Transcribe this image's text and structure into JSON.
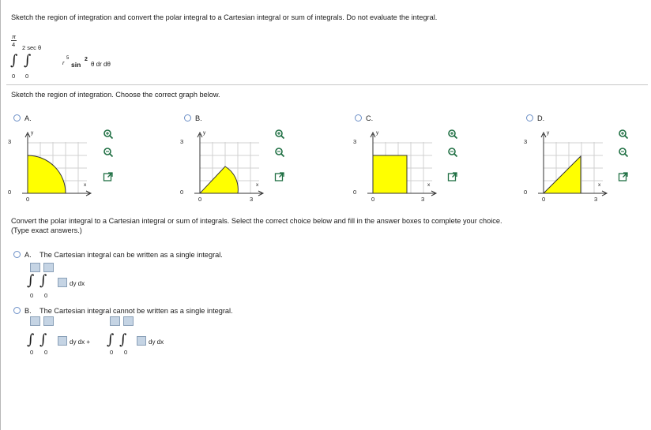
{
  "question": {
    "prompt": "Sketch the region of integration and convert the polar integral to a Cartesian integral or sum of integrals. Do not evaluate the integral.",
    "integral": {
      "outer_upper": "π",
      "outer_upper_den": "4",
      "outer_lower": "0",
      "inner_upper": "2 sec θ",
      "inner_lower": "0",
      "integrand_r": "r",
      "integrand_r_exp": "5",
      "integrand_trig": "sin",
      "integrand_trig_exp": "2",
      "integrand_rest": "θ dr dθ"
    }
  },
  "part1": {
    "instruction": "Sketch the region of integration. Choose the correct graph below.",
    "options": [
      {
        "letter": "A.",
        "y_tick": "3",
        "y_zero": "0",
        "x_zero": "0",
        "x_label": "x",
        "y_label": "y",
        "shape": "quarter-circle"
      },
      {
        "letter": "B.",
        "y_tick": "3",
        "y_zero": "0",
        "x_zero": "0",
        "x_three": "3",
        "x_label": "x",
        "y_label": "y",
        "shape": "sector"
      },
      {
        "letter": "C.",
        "y_tick": "3",
        "y_zero": "0",
        "x_zero": "0",
        "x_three": "3",
        "x_label": "x",
        "y_label": "y",
        "shape": "square"
      },
      {
        "letter": "D.",
        "y_tick": "3",
        "y_zero": "0",
        "x_zero": "0",
        "x_three": "3",
        "x_label": "x",
        "y_label": "y",
        "shape": "triangle"
      }
    ],
    "fill_color": "#ffff00",
    "grid_color": "#d0d0d0"
  },
  "part2": {
    "instruction_line1": "Convert the polar integral to a Cartesian integral or sum of integrals. Select the correct choice below and fill in the answer boxes to complete your choice.",
    "instruction_line2": "(Type exact answers.)",
    "choiceA": {
      "letter": "A.",
      "text": "The Cartesian integral can be written as a single integral.",
      "lower1": "0",
      "lower2": "0",
      "diff": "dy dx"
    },
    "choiceB": {
      "letter": "B.",
      "text": "The Cartesian integral cannot be written as a single integral.",
      "lower1": "0",
      "lower2": "0",
      "diff1": "dy dx +",
      "lower3": "0",
      "lower4": "0",
      "diff2": "dy dx"
    }
  }
}
